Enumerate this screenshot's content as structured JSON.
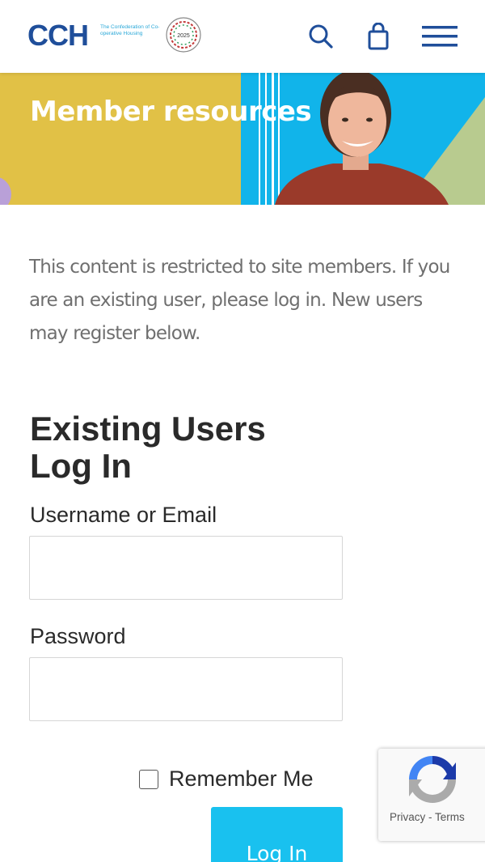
{
  "header": {
    "logo_text": "CCH",
    "logo_subtitle": "The Confederation of Co-operative Housing",
    "seal_text": "2025",
    "brand_color": "#1f4e9a",
    "icons": [
      "search-icon",
      "shopping-bag-icon",
      "hamburger-menu-icon"
    ]
  },
  "hero": {
    "title": "Member resources"
  },
  "intro": {
    "text": "This content is restricted to site members. If you are an existing user, please log in. New users may register below."
  },
  "login": {
    "heading": "Existing Users Log In",
    "username_label": "Username or Email",
    "username_value": "",
    "password_label": "Password",
    "password_value": "",
    "remember_label": "Remember Me",
    "remember_checked": false,
    "button_label": "Log In",
    "button_color": "#19c1ef"
  },
  "recaptcha": {
    "links": "Privacy - Terms"
  }
}
